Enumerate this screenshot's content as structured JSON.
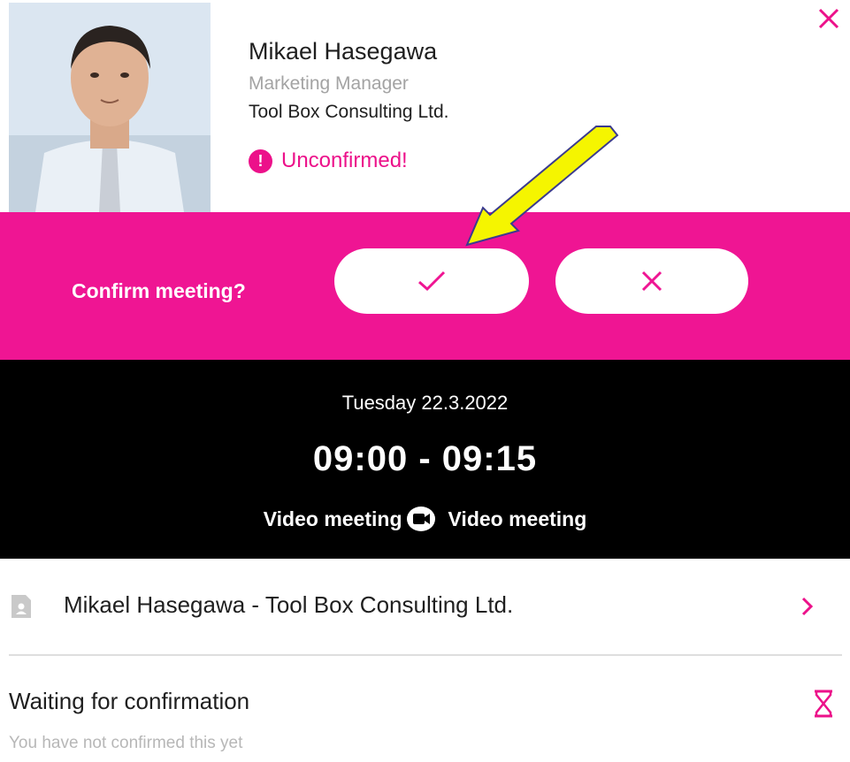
{
  "contact": {
    "name": "Mikael Hasegawa",
    "title": "Marketing Manager",
    "company": "Tool Box Consulting Ltd.",
    "status": "Unconfirmed!",
    "status_icon": "exclamation-icon",
    "avatar_icon": "person-photo"
  },
  "confirm": {
    "label": "Confirm meeting?",
    "accept_icon": "checkmark-icon",
    "decline_icon": "close-icon"
  },
  "meeting": {
    "date": "Tuesday 22.3.2022",
    "time": "09:00 - 09:15",
    "type_label": "Video meeting",
    "type_icon": "video-camera-icon",
    "location_label": "Video meeting"
  },
  "participant_row": {
    "label": "Mikael Hasegawa - Tool Box Consulting Ltd.",
    "icon": "document-icon",
    "chevron_icon": "chevron-right-icon"
  },
  "waiting": {
    "title": "Waiting for confirmation",
    "subtitle": "You have not confirmed this yet",
    "icon": "hourglass-icon"
  },
  "colors": {
    "accent": "#ef1593",
    "status_pink": "#ec118a",
    "annotation_arrow": "#f5f500"
  }
}
